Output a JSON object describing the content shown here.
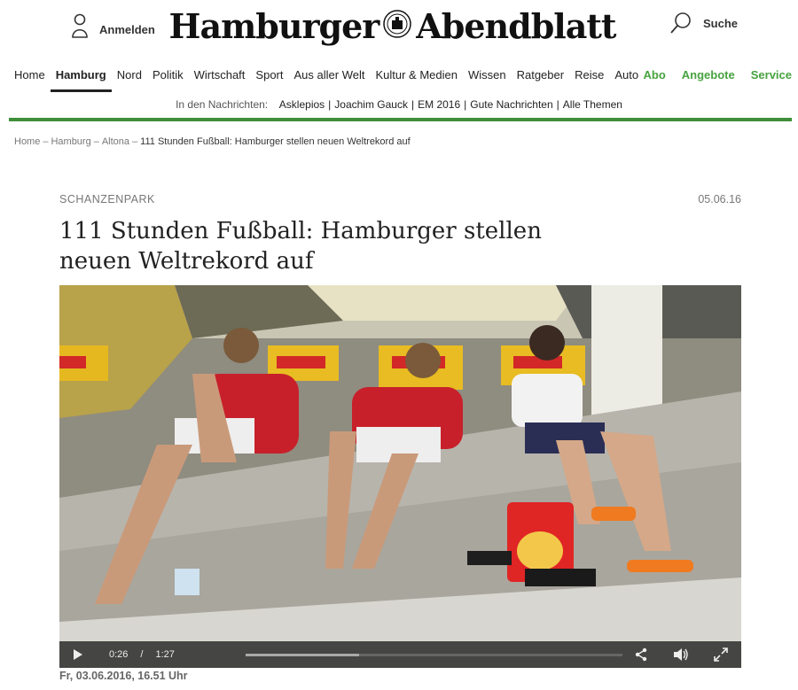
{
  "header": {
    "login_label": "Anmelden",
    "logo_left": "Hamburger",
    "logo_right": "Abendblatt",
    "search_label": "Suche"
  },
  "nav": {
    "items": [
      {
        "label": "Home"
      },
      {
        "label": "Hamburg",
        "active": true
      },
      {
        "label": "Nord"
      },
      {
        "label": "Politik"
      },
      {
        "label": "Wirtschaft"
      },
      {
        "label": "Sport"
      },
      {
        "label": "Aus aller Welt"
      },
      {
        "label": "Kultur & Medien"
      },
      {
        "label": "Wissen"
      },
      {
        "label": "Ratgeber"
      },
      {
        "label": "Reise"
      },
      {
        "label": "Auto"
      }
    ],
    "right_items": [
      {
        "label": "Abo"
      },
      {
        "label": "Angebote"
      },
      {
        "label": "Service"
      }
    ],
    "accent_color": "#47a23f"
  },
  "news": {
    "label": "In den Nachrichten:",
    "links": [
      "Asklepios",
      "Joachim Gauck",
      "EM 2016",
      "Gute Nachrichten",
      "Alle Themen"
    ]
  },
  "breadcrumb": {
    "items": [
      "Home",
      "Hamburg",
      "Altona"
    ],
    "current": "111 Stunden Fußball: Hamburger stellen neuen Weltrekord auf"
  },
  "article": {
    "kicker": "SCHANZENPARK",
    "date": "05.06.16",
    "headline": "111 Stunden Fußball: Hamburger stellen neuen Weltrekord auf",
    "video_date": "Fr, 03.06.2016, 16.51 Uhr"
  },
  "video": {
    "current_time": "0:26",
    "time_separator": "/",
    "duration": "1:27",
    "progress": 0.3,
    "icons": [
      "play-icon",
      "share-icon",
      "volume-icon",
      "fullscreen-icon"
    ]
  }
}
